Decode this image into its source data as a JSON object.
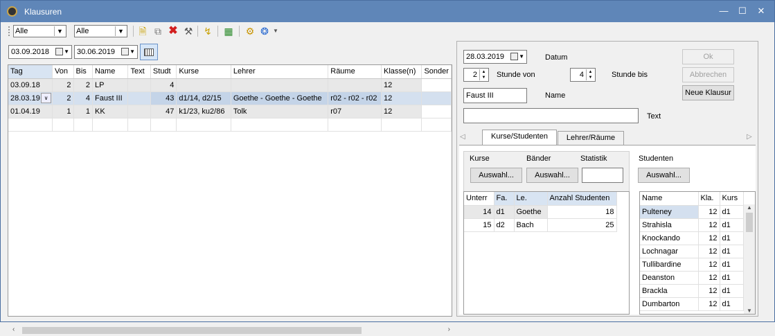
{
  "window": {
    "title": "Klausuren"
  },
  "toolbar": {
    "filter1": "Alle",
    "filter2": "Alle",
    "icons": [
      "new-icon",
      "copy-icon",
      "delete-icon",
      "tools-icon",
      "refresh-icon",
      "export-icon",
      "settings-icon",
      "help-icon"
    ]
  },
  "filter": {
    "from": "03.09.2018",
    "to": "30.06.2019"
  },
  "main_grid": {
    "columns": [
      "Tag",
      "Von",
      "Bis",
      "Name",
      "Text",
      "Studt",
      "Kurse",
      "Lehrer",
      "Räume",
      "Klasse(n)",
      "Sonder"
    ],
    "rows": [
      [
        "03.09.18",
        "2",
        "2",
        "LP",
        "",
        "4",
        "",
        "",
        "",
        "12",
        ""
      ],
      [
        "28.03.19",
        "2",
        "4",
        "Faust III",
        "",
        "43",
        "d1/14, d2/15",
        "Goethe - Goethe - Goethe",
        "r02 - r02 - r02",
        "12",
        ""
      ],
      [
        "01.04.19",
        "1",
        "1",
        "KK",
        "",
        "47",
        "k1/23, ku2/86",
        "Tolk",
        "r07",
        "12",
        ""
      ]
    ]
  },
  "detail": {
    "date": "28.03.2019",
    "date_label": "Datum",
    "hour_from": "2",
    "hour_from_label": "Stunde von",
    "hour_to": "4",
    "hour_to_label": "Stunde bis",
    "name": "Faust III",
    "name_label": "Name",
    "text": "",
    "text_label": "Text",
    "ok": "Ok",
    "cancel": "Abbrechen",
    "new": "Neue Klausur"
  },
  "tabs": [
    "Kurse/Studenten",
    "Lehrer/Räume"
  ],
  "kurse_tab": {
    "kurse_label": "Kurse",
    "baender_label": "Bänder",
    "statistik_label": "Statistik",
    "studenten_label": "Studenten",
    "select_btn": "Auswahl...",
    "kurse_grid": {
      "columns": [
        "Unterr",
        "Fa.",
        "Le.",
        "Anzahl Studenten"
      ],
      "rows": [
        [
          "14",
          "d1",
          "Goethe",
          "18"
        ],
        [
          "15",
          "d2",
          "Bach",
          "25"
        ]
      ]
    },
    "students_grid": {
      "columns": [
        "Name",
        "Kla.",
        "Kurs"
      ],
      "rows": [
        [
          "Pulteney",
          "12",
          "d1"
        ],
        [
          "Strahisla",
          "12",
          "d1"
        ],
        [
          "Knockando",
          "12",
          "d1"
        ],
        [
          "Lochnagar",
          "12",
          "d1"
        ],
        [
          "Tullibardine",
          "12",
          "d1"
        ],
        [
          "Deanston",
          "12",
          "d1"
        ],
        [
          "Brackla",
          "12",
          "d1"
        ],
        [
          "Dumbarton",
          "12",
          "d1"
        ]
      ]
    }
  }
}
